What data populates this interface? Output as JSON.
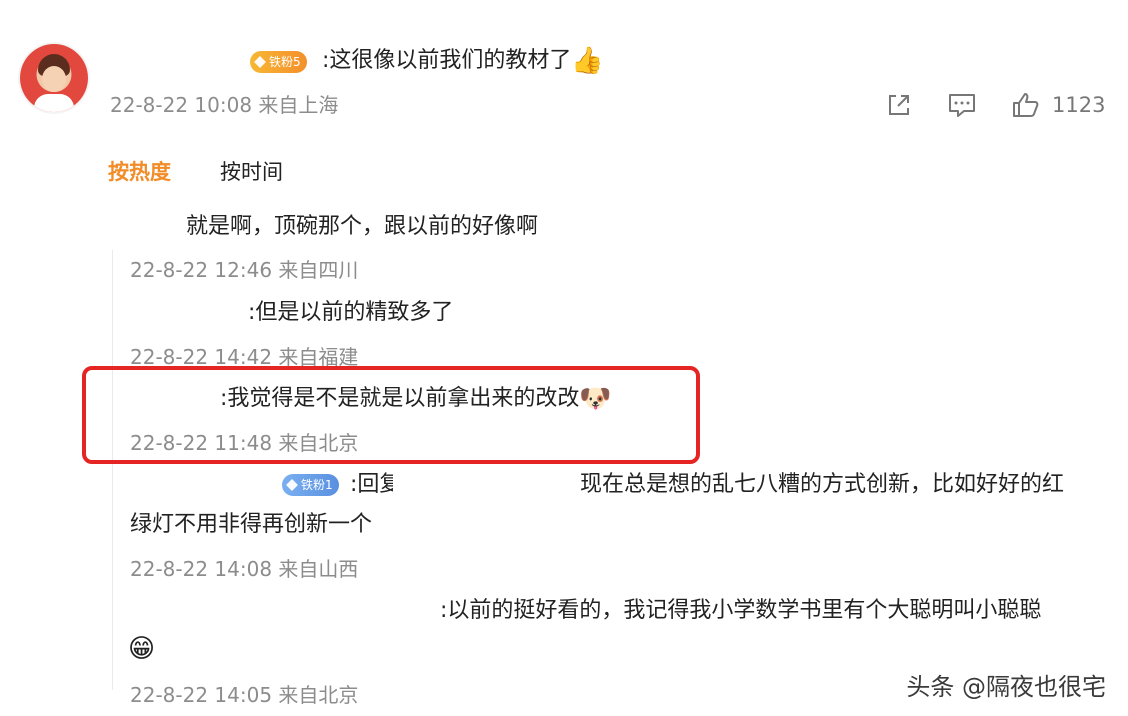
{
  "post": {
    "badge": "铁粉5",
    "text": ":这很像以前我们的教材了",
    "emoji": "👍",
    "time": "22-8-22 10:08 来自上海",
    "like_count": "1123"
  },
  "icons": {
    "share": "share-icon",
    "comment": "comment-icon",
    "like": "thumbs-up-icon"
  },
  "sort": {
    "hot": "按热度",
    "time": "按时间"
  },
  "replies": [
    {
      "text": "就是啊，顶碗那个，跟以前的好像啊",
      "time": "22-8-22 12:46 来自四川"
    },
    {
      "text": ":但是以前的精致多了",
      "time": "22-8-22 14:42 来自福建"
    },
    {
      "text": ":我觉得是不是就是以前拿出来的改改",
      "emoji": "🐶",
      "time": "22-8-22 11:48 来自北京"
    },
    {
      "badge": "铁粉1",
      "text_a": ":回复",
      "text_b": "现在总是想的乱七八糟的方式创新，比如好好的红",
      "text_c": "绿灯不用非得再创新一个",
      "time": "22-8-22 14:08 来自山西"
    },
    {
      "text": ":以前的挺好看的，我记得我小学数学书里有个大聪明叫小聪聪",
      "emoji": "😁",
      "time": "22-8-22 14:05 来自北京"
    }
  ],
  "watermark": "头条 @隔夜也很宅",
  "colors": {
    "accent": "#f28c28",
    "highlight": "#e52424",
    "meta": "#8c8c8c"
  }
}
